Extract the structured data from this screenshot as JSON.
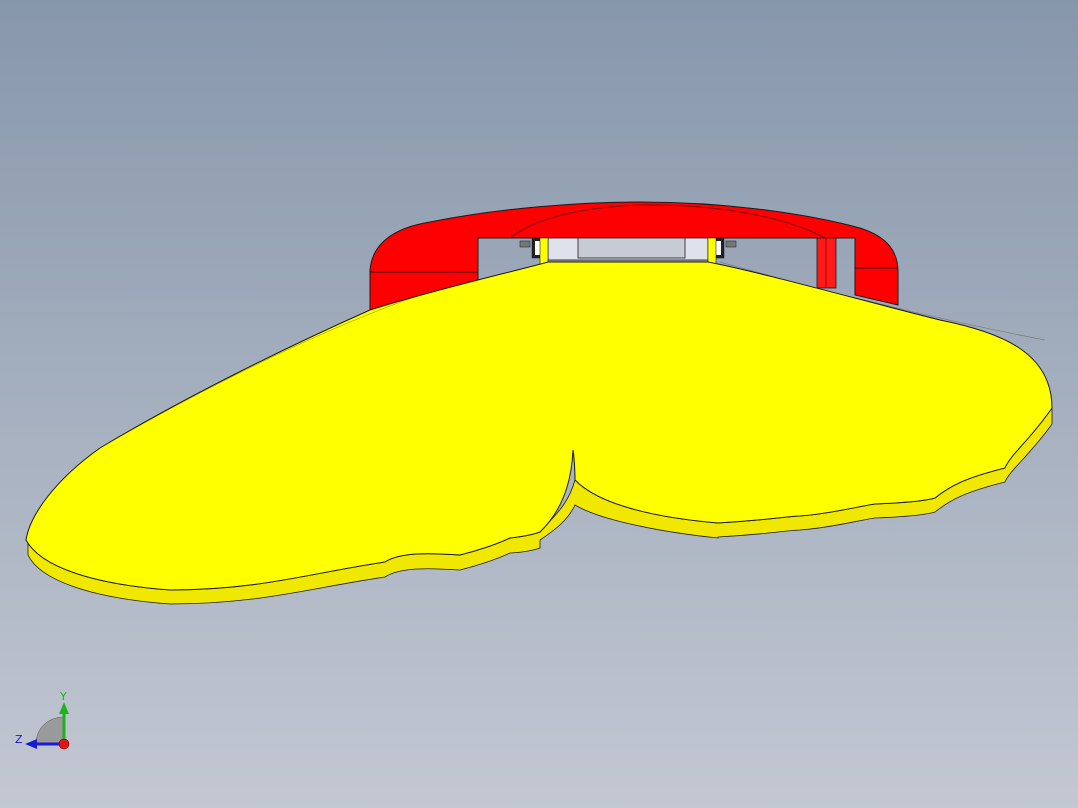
{
  "viewport": {
    "background_top": "#8797ab",
    "background_bottom": "#c3c8d2"
  },
  "model": {
    "top_part_color": "#ff0000",
    "base_part_color": "#ffff00",
    "edge_color": "#1a1a1a"
  },
  "triad": {
    "y_label": "Y",
    "z_label": "Z",
    "y_color": "#1db31d",
    "z_color": "#1a1ad6",
    "x_color": "#e01515"
  }
}
